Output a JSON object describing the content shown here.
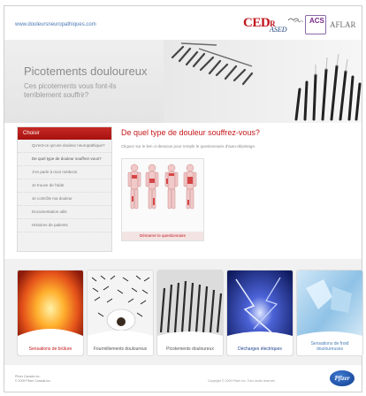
{
  "header": {
    "site_url": "www.douleursneuropathiques.com",
    "logos": {
      "ced_text": "CED",
      "ced_sub": "R",
      "ased_text": "ASED",
      "acs_text": "ACS",
      "aflar_text": "AFLAR",
      "pfizer_text": "Pfizer"
    }
  },
  "banner": {
    "title": "Picotements douloureux",
    "subtitle": "Ces picotements vous font-ils terriblement souffrir?"
  },
  "sidebar": {
    "heading": "Choisir",
    "items": [
      {
        "label": "Qu'est-ce qu'une douleur neuropathique?"
      },
      {
        "label": "De quel type de douleur souffrez-vous?"
      },
      {
        "label": "J'en parle à mon médecin"
      },
      {
        "label": "Je trouve de l'aide"
      },
      {
        "label": "Je contrôle ma douleur"
      },
      {
        "label": "Documentation utile"
      },
      {
        "label": "Histoires de patients"
      }
    ],
    "active_index": 1
  },
  "main": {
    "title": "De quel type de douleur souffrez-vous?",
    "instructions": "Cliquez sur le lien ci-dessous pour remplir le questionnaire d'auto-dépistage.",
    "bodymap_button": "Démarrer le questionnaire"
  },
  "tiles": [
    {
      "label": "Sensations de brûlure",
      "color": "#c4181a"
    },
    {
      "label": "Fourmillements douloureux",
      "color": "#555555"
    },
    {
      "label": "Picotements douloureux",
      "color": "#555555"
    },
    {
      "label": "Décharges électriques",
      "color": "#1e3f8f"
    },
    {
      "label": "Sensations de froid douloureuses",
      "color": "#4a7fb5"
    }
  ],
  "footer": {
    "line1": "Pfizer Canada inc.",
    "line2": "© 2009 Pfizer Canada inc.",
    "copyright": "Copyright © 2009 Pfizer Inc. Tous droits réservés"
  }
}
